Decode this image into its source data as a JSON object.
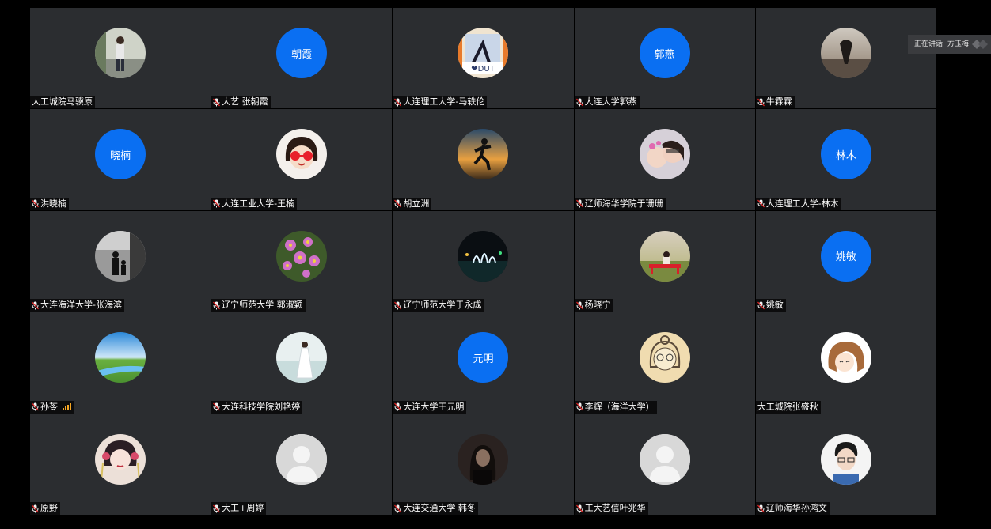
{
  "speaking_indicator": {
    "label": "正在讲话: 方玉梅"
  },
  "accent_color": "#0a6ff2",
  "participants": [
    {
      "name": "大工城院马骥原",
      "avatar": "photo-man-standing",
      "muted": false,
      "text": ""
    },
    {
      "name": "大艺 张朝霞",
      "avatar": "text",
      "muted": true,
      "text": "朝霞"
    },
    {
      "name": "大连理工大学-马轶伦",
      "avatar": "photo-dut-poster",
      "muted": true,
      "text": ""
    },
    {
      "name": "大连大学郭燕",
      "avatar": "text",
      "muted": true,
      "text": "郭燕"
    },
    {
      "name": "牛霖霖",
      "avatar": "photo-heart-hands",
      "muted": true,
      "text": ""
    },
    {
      "name": "洪晓楠",
      "avatar": "text",
      "muted": true,
      "text": "晓楠"
    },
    {
      "name": "大连工业大学-王楠",
      "avatar": "photo-cartoon-girl",
      "muted": true,
      "text": ""
    },
    {
      "name": "胡立洲",
      "avatar": "photo-runner-sunset",
      "muted": true,
      "text": ""
    },
    {
      "name": "辽师海华学院于珊珊",
      "avatar": "photo-two-girls",
      "muted": true,
      "text": ""
    },
    {
      "name": "大连理工大学-林木",
      "avatar": "text",
      "muted": true,
      "text": "林木"
    },
    {
      "name": "大连海洋大学-张海滨",
      "avatar": "photo-silhouette-bw",
      "muted": true,
      "text": ""
    },
    {
      "name": "辽宁师范大学 郭淑颖",
      "avatar": "photo-pink-flowers",
      "muted": true,
      "text": ""
    },
    {
      "name": "辽宁师范大学于永成",
      "avatar": "photo-night-fountain",
      "muted": true,
      "text": ""
    },
    {
      "name": "杨晓宁",
      "avatar": "photo-red-bench",
      "muted": true,
      "text": ""
    },
    {
      "name": "姚敏",
      "avatar": "text",
      "muted": true,
      "text": "姚敏"
    },
    {
      "name": "孙苓",
      "avatar": "photo-sky-river",
      "muted": true,
      "text": "",
      "signal": true
    },
    {
      "name": "大连科技学院刘艳婷",
      "avatar": "photo-bride-beach",
      "muted": true,
      "text": ""
    },
    {
      "name": "大连大学王元明",
      "avatar": "text",
      "muted": true,
      "text": "元明"
    },
    {
      "name": "李辉（海洋大学）",
      "avatar": "photo-sketch-girl",
      "muted": true,
      "text": ""
    },
    {
      "name": "大工城院张盛秋",
      "avatar": "photo-anime-girl",
      "muted": false,
      "text": ""
    },
    {
      "name": "原野",
      "avatar": "photo-chinese-painting",
      "muted": true,
      "text": ""
    },
    {
      "name": "大工+周婷",
      "avatar": "default",
      "muted": true,
      "text": ""
    },
    {
      "name": "大连交通大学 韩冬",
      "avatar": "photo-dark-portrait",
      "muted": true,
      "text": ""
    },
    {
      "name": "工大艺信叶兆华",
      "avatar": "default",
      "muted": true,
      "text": ""
    },
    {
      "name": "辽师海华孙鸿文",
      "avatar": "photo-young-man",
      "muted": true,
      "text": ""
    }
  ]
}
